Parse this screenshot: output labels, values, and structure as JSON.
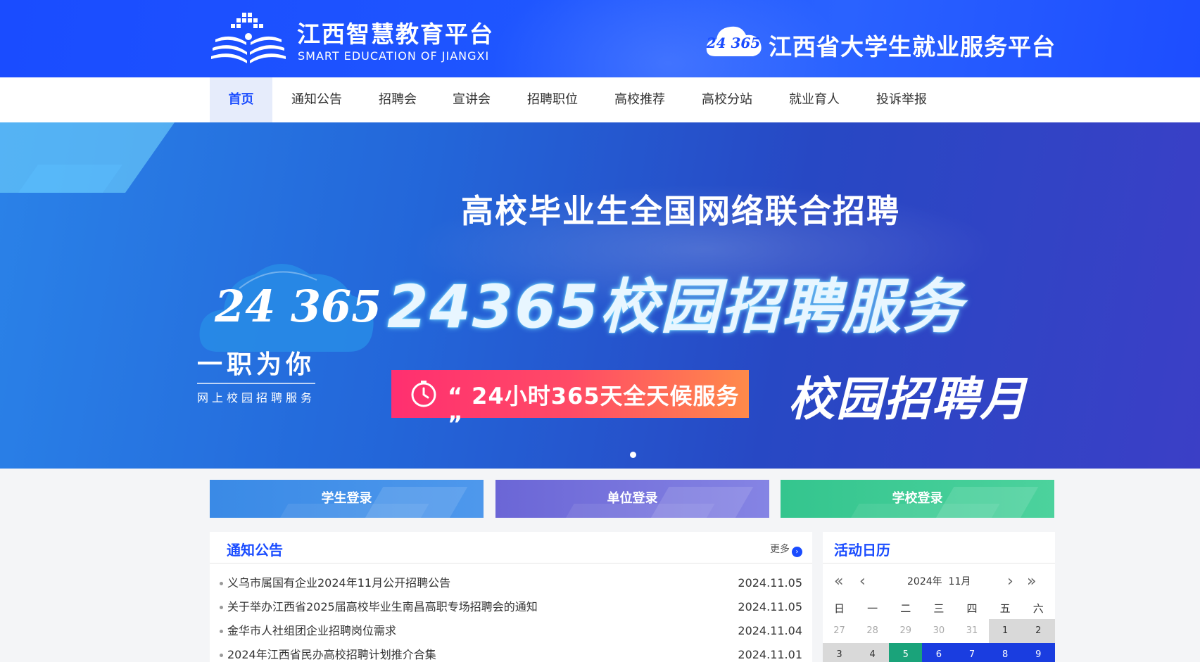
{
  "header": {
    "brand_cn": "江西智慧教育平台",
    "brand_en": "SMART EDUCATION OF JIANGXI",
    "platform_badge": "24 365",
    "platform_title": "江西省大学生就业服务平台"
  },
  "nav": {
    "items": [
      "首页",
      "通知公告",
      "招聘会",
      "宣讲会",
      "招聘职位",
      "高校推荐",
      "高校分站",
      "就业育人",
      "投诉举报"
    ],
    "active": "首页"
  },
  "banner": {
    "title": "高校毕业生全国网络联合招聘",
    "cloud_number": "24 365",
    "slogan": "一职为你",
    "sub_slogan": "网上校园招聘服务",
    "main_text": "24365校园招聘服务",
    "pill_text": "“ 24小时365天全天候服务 ”",
    "month_text": "校园招聘月"
  },
  "login": {
    "student": "学生登录",
    "unit": "单位登录",
    "school": "学校登录"
  },
  "notice": {
    "title": "通知公告",
    "more": "更多",
    "items": [
      {
        "text": "义乌市属国有企业2024年11月公开招聘公告",
        "date": "2024.11.05"
      },
      {
        "text": "关于举办江西省2025届高校毕业生南昌高职专场招聘会的通知",
        "date": "2024.11.05"
      },
      {
        "text": "金华市人社组团企业招聘岗位需求",
        "date": "2024.11.04"
      },
      {
        "text": "2024年江西省民办高校招聘计划推介合集",
        "date": "2024.11.01"
      }
    ]
  },
  "calendar": {
    "title": "活动日历",
    "year": "2024年",
    "month": "11月",
    "weekdays": [
      "日",
      "一",
      "二",
      "三",
      "四",
      "五",
      "六"
    ],
    "rows": [
      [
        "27",
        "28",
        "29",
        "30",
        "31",
        "1",
        "2"
      ],
      [
        "3",
        "4",
        "5",
        "6",
        "7",
        "8",
        "9"
      ]
    ]
  },
  "colors": {
    "brand_blue": "#1a4cff",
    "student_btn": "#3a8ae6",
    "unit_btn": "#6b66d6",
    "school_btn": "#34c58e",
    "calendar_today": "#1aa37a",
    "calendar_event": "#1a3de0"
  }
}
